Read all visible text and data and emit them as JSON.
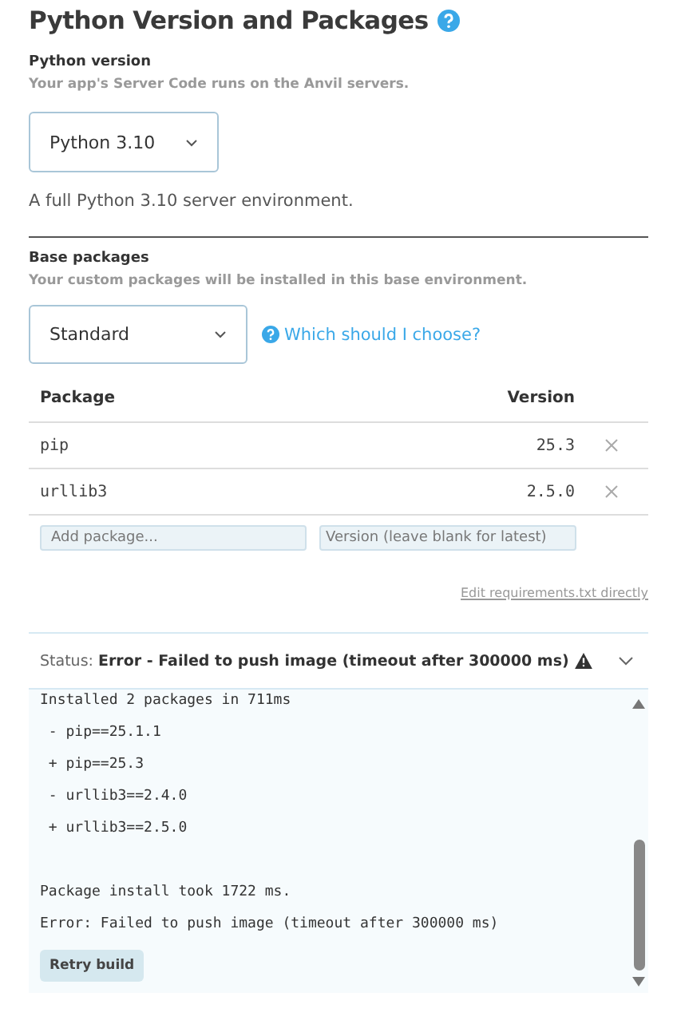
{
  "title": "Python Version and Packages",
  "python_version": {
    "label": "Python version",
    "hint": "Your app's Server Code runs on the Anvil servers.",
    "value": "Python 3.10",
    "description": "A full Python 3.10 server environment."
  },
  "base_packages": {
    "label": "Base packages",
    "hint": "Your custom packages will be installed in this base environment.",
    "value": "Standard",
    "help_link": "Which should I choose?"
  },
  "table": {
    "columns": [
      "Package",
      "Version"
    ],
    "rows": [
      {
        "package": "pip",
        "version": "25.3"
      },
      {
        "package": "urllib3",
        "version": "2.5.0"
      }
    ]
  },
  "add_package": {
    "placeholder": "Add package..."
  },
  "add_version": {
    "placeholder": "Version (leave blank for latest)"
  },
  "edit_link": "Edit requirements.txt directly",
  "status": {
    "label": "Status:",
    "message": "Error - Failed to push image (timeout after 300000 ms)",
    "expanded": true
  },
  "log_lines": [
    {
      "text": "Installed 2 packages in 711ms",
      "blank_before": false
    },
    {
      "text": " - pip==25.1.1",
      "blank_before": false
    },
    {
      "text": " + pip==25.3",
      "blank_before": false
    },
    {
      "text": " - urllib3==2.4.0",
      "blank_before": false
    },
    {
      "text": " + urllib3==2.5.0",
      "blank_before": false
    },
    {
      "text": "Package install took 1722 ms.",
      "blank_before": true
    },
    {
      "text": "Error: Failed to push image (timeout after 300000 ms)",
      "blank_before": false
    }
  ],
  "retry_button": "Retry build"
}
